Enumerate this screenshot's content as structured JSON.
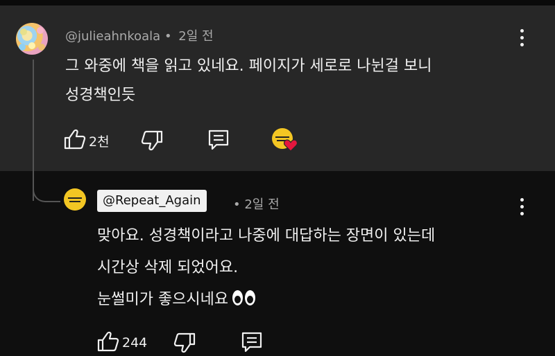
{
  "parent_comment": {
    "author": "@julieahnkoala",
    "separator": "•",
    "time": "2일 전",
    "text_line1": "그 와중에 책을 읽고 있네요. 페이지가 세로로 나뉜걸 보니",
    "text_line2": "성경책인듯",
    "like_count": "2천"
  },
  "reply": {
    "author": "@Repeat_Again",
    "separator": "•",
    "time": "2일 전",
    "text_line1": "맞아요. 성경책이라고 나중에 대답하는 장면이 있는데",
    "text_line2": "시간상 삭제 되었어요.",
    "text_line3": "눈썰미가 좋으시네요",
    "like_count": "244"
  },
  "icons": [
    "thumbs-up-icon",
    "thumbs-down-icon",
    "reply-icon",
    "more-vertical-icon",
    "creator-heart-icon",
    "eyes-emoji"
  ],
  "colors": {
    "parent_bg": "#272727",
    "page_bg": "#0f0f0f",
    "meta_text": "#aaaaaa",
    "heart": "#e4173e",
    "creator_avatar": "#f3c623"
  }
}
